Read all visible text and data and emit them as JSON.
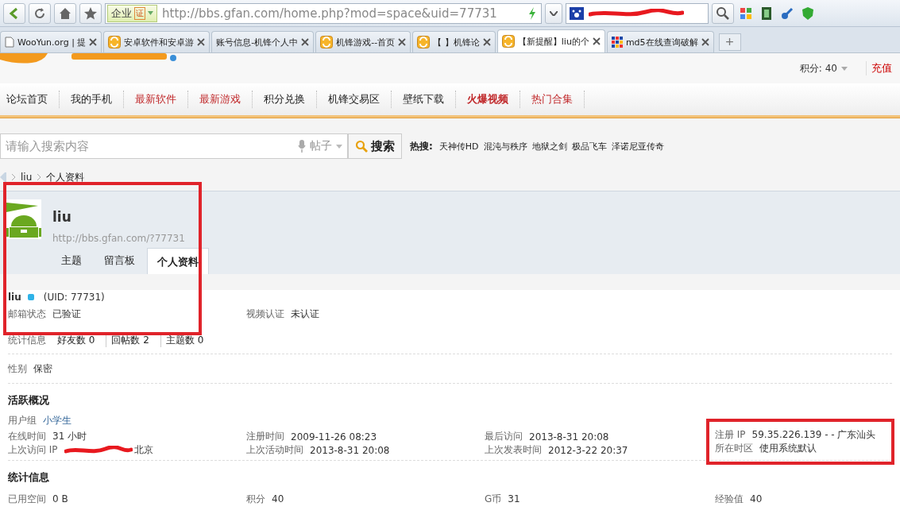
{
  "browser": {
    "url_badge": "企业",
    "url_badge_mark": "证",
    "url": "http://bbs.gfan.com/home.php?mod=space&uid=77731",
    "search_redacted": true,
    "tabs": [
      {
        "label": "WooYun.org | 提",
        "selected": false,
        "kind": "page"
      },
      {
        "label": "安卓软件和安卓游",
        "selected": false,
        "kind": "site"
      },
      {
        "label": "账号信息-机锋个人中",
        "selected": false,
        "kind": "blank"
      },
      {
        "label": "机锋游戏--首页",
        "selected": false,
        "kind": "site"
      },
      {
        "label": "【        】机锋论",
        "selected": false,
        "kind": "site"
      },
      {
        "label": "【新提醒】liu的个",
        "selected": true,
        "kind": "site"
      },
      {
        "label": "md5在线查询破解",
        "selected": false,
        "kind": "grid"
      }
    ],
    "new_tab": "+"
  },
  "site_header": {
    "points": "积分: 40",
    "recharge": "充值"
  },
  "nav": [
    {
      "label": "论坛首页",
      "kind": "normal"
    },
    {
      "label": "我的手机",
      "kind": "normal"
    },
    {
      "label": "最新软件",
      "kind": "hot"
    },
    {
      "label": "最新游戏",
      "kind": "hot"
    },
    {
      "label": "积分兑换",
      "kind": "normal"
    },
    {
      "label": "机锋交易区",
      "kind": "normal"
    },
    {
      "label": "壁纸下载",
      "kind": "normal"
    },
    {
      "label": "火爆视频",
      "kind": "featured"
    },
    {
      "label": "热门合集",
      "kind": "hot"
    }
  ],
  "search": {
    "placeholder": "请输入搜索内容",
    "scope": "帖子",
    "button": "搜索",
    "hot_label": "热搜:",
    "hot_words": [
      "天神传HD",
      "混沌与秩序",
      "地狱之剑",
      "极品飞车",
      "泽诺尼亚传奇"
    ]
  },
  "breadcrumb": [
    "liu",
    "个人资料"
  ],
  "profile": {
    "highlighted": true,
    "name": "liu",
    "url": "http://bbs.gfan.com/?77731",
    "tabs": [
      {
        "label": "主题",
        "selected": false
      },
      {
        "label": "留言板",
        "selected": false
      },
      {
        "label": "个人资料",
        "selected": true
      }
    ]
  },
  "info": {
    "name": "liu",
    "uid": "(UID: 77731)",
    "status": [
      {
        "label": "邮箱状态",
        "value": "已验证"
      },
      {
        "label": "视频认证",
        "value": "未认证"
      }
    ],
    "stats_label": "统计信息",
    "stats": [
      {
        "label": "好友数",
        "value": "0"
      },
      {
        "label": "回帖数",
        "value": "2"
      },
      {
        "label": "主题数",
        "value": "0"
      }
    ],
    "gender": {
      "label": "性别",
      "value": "保密"
    }
  },
  "activity": {
    "title": "活跃概况",
    "group": {
      "label": "用户组",
      "value": "小学生"
    },
    "columns": [
      {
        "highlighted": false,
        "fields": [
          {
            "label": "在线时间",
            "value": "31 小时",
            "redacted": false
          },
          {
            "label": "上次访问 IP",
            "value": "北京",
            "redacted": true
          }
        ]
      },
      {
        "highlighted": false,
        "fields": [
          {
            "label": "注册时间",
            "value": "2009-11-26 08:23",
            "redacted": false
          },
          {
            "label": "上次活动时间",
            "value": "2013-8-31 20:08",
            "redacted": false
          }
        ]
      },
      {
        "highlighted": false,
        "fields": [
          {
            "label": "最后访问",
            "value": "2013-8-31 20:08",
            "redacted": false
          },
          {
            "label": "上次发表时间",
            "value": "2012-3-22 20:37",
            "redacted": false
          }
        ]
      },
      {
        "highlighted": true,
        "fields": [
          {
            "label": "注册 IP",
            "value": "59.35.226.139 - - 广东汕头",
            "redacted": false
          },
          {
            "label": "所在时区",
            "value": "使用系统默认",
            "redacted": false
          }
        ]
      }
    ]
  },
  "statistics": {
    "title": "统计信息",
    "fields": [
      {
        "label": "已用空间",
        "value": "0 B"
      },
      {
        "label": "积分",
        "value": "40"
      },
      {
        "label": "G币",
        "value": "31"
      },
      {
        "label": "经验值",
        "value": "40"
      }
    ]
  }
}
